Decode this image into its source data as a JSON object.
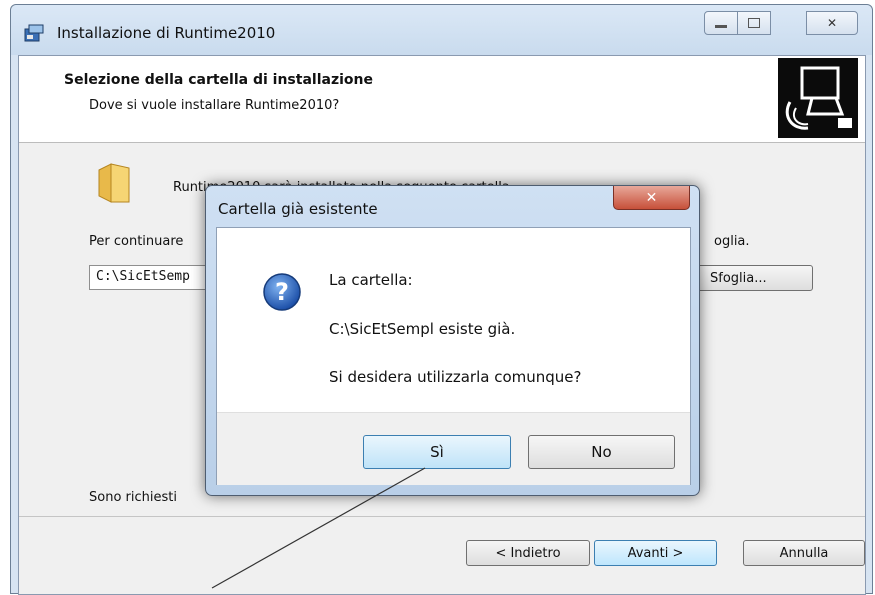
{
  "window": {
    "title": "Installazione di Runtime2010",
    "min_glyph": "▭",
    "max_glyph": "▢",
    "close_glyph": "✕"
  },
  "header": {
    "title": "Selezione della cartella di installazione",
    "subtitle": "Dove si vuole installare Runtime2010?",
    "logo_icon": "installer-computer-icon"
  },
  "content": {
    "folder_icon": "folder-icon",
    "line1_partial": "Runtime2010 sarà installato nella seguente cartella.",
    "line2_left": "Per continuare",
    "line2_right": "oglia.",
    "path_value": "C:\\SicEtSemp",
    "browse_label": "Sfoglia...",
    "space_left": "Sono richiesti"
  },
  "footer": {
    "back_label": "< Indietro",
    "next_label": "Avanti >",
    "cancel_label": "Annulla"
  },
  "dialog": {
    "title": "Cartella già esistente",
    "close_glyph": "✕",
    "icon": "question-icon",
    "line1": "La cartella:",
    "line2": "C:\\SicEtSempl esiste già.",
    "line3": "Si desidera utilizzarla comunque?",
    "yes_label": "Sì",
    "no_label": "No"
  },
  "colors": {
    "window_frame": "#c9dbee",
    "dialog_close": "#c7503a",
    "default_button": "#bee6fd"
  }
}
